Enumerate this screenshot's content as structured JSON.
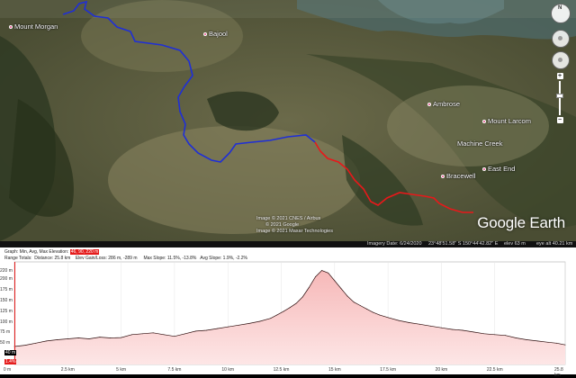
{
  "map": {
    "places": [
      {
        "id": "mount-morgan",
        "label": "Mount Morgan"
      },
      {
        "id": "bajool",
        "label": "Bajool"
      },
      {
        "id": "ambrose",
        "label": "Ambrose"
      },
      {
        "id": "mount-larcom",
        "label": "Mount Larcom"
      },
      {
        "id": "machine-creek",
        "label": "Machine Creek"
      },
      {
        "id": "east-end",
        "label": "East End"
      },
      {
        "id": "bracewell",
        "label": "Bracewell"
      }
    ],
    "credits": [
      "Image © 2021 CNES / Airbus",
      "© 2021 Google",
      "Image © 2021 Maxar Technologies"
    ],
    "logo": "Google Earth",
    "status": {
      "imagery_date": "Imagery Date: 6/24/2020",
      "coords": "23°48'51.58\" S  150°44'42.82\" E",
      "elev": "elev   63 m",
      "eye_alt": "eye alt  40.21 km"
    },
    "compass_label": "N",
    "zoom_plus": "+",
    "zoom_minus": "−",
    "route_colors": {
      "covered": "#1f2fd6",
      "remaining": "#e8181a"
    }
  },
  "profile": {
    "line1": {
      "prefix": "Graph: Min, Avg, Max Elevation:",
      "highlight": "46, 90, 220 m"
    },
    "line2": {
      "range_totals": "Range Totals:",
      "distance": "Distance: 25.8 km",
      "gain_loss": "Elev Gain/Loss: 286 m, -289 m",
      "max_slope": "Max Slope: 11.5%, -13.8%",
      "avg_slope": "Avg Slope: 1.9%, -2.2%"
    },
    "cursor": {
      "elev_label": "40 m",
      "slope_label": "1.4%",
      "fraction": 0.0
    },
    "colors": {
      "fill": "#f6b8b8",
      "line": "#2a0a0a",
      "highlight": "#e41c1c"
    }
  },
  "chart_data": {
    "type": "area",
    "title": "",
    "xlabel": "",
    "ylabel": "",
    "xlim": [
      0,
      25.8
    ],
    "ylim": [
      0,
      240
    ],
    "y_ticks": [
      "220 m",
      "200 m",
      "175 m",
      "150 m",
      "125 m",
      "100 m",
      "75 m",
      "50 m"
    ],
    "y_tick_values": [
      220,
      200,
      175,
      150,
      125,
      100,
      75,
      50
    ],
    "x_ticks": [
      "0 m",
      "2.5 km",
      "5 km",
      "7.5 km",
      "10 km",
      "12.5 km",
      "15 km",
      "17.5 km",
      "20 km",
      "22.5 km",
      "25.8 km"
    ],
    "x_tick_values": [
      0,
      2.5,
      5,
      7.5,
      10,
      12.5,
      15,
      17.5,
      20,
      22.5,
      25.8
    ],
    "series": [
      {
        "x": [
          0,
          0.5,
          1,
          1.5,
          2,
          2.5,
          3,
          3.5,
          4,
          4.5,
          5,
          5.5,
          6,
          6.5,
          7,
          7.5,
          8,
          8.5,
          9,
          9.5,
          10,
          10.5,
          11,
          11.5,
          12,
          12.3,
          12.6,
          12.9,
          13.2,
          13.5,
          13.8,
          14.1,
          14.4,
          14.7,
          15,
          15.3,
          15.6,
          15.9,
          16.2,
          16.5,
          16.8,
          17.1,
          17.5,
          18,
          18.5,
          19,
          19.5,
          20,
          20.5,
          21,
          21.5,
          22,
          22.5,
          23,
          23.5,
          24,
          24.5,
          25,
          25.4,
          25.8
        ],
        "y": [
          42,
          45,
          50,
          55,
          58,
          60,
          62,
          60,
          64,
          62,
          63,
          70,
          72,
          74,
          70,
          66,
          72,
          78,
          80,
          84,
          88,
          92,
          96,
          101,
          108,
          116,
          124,
          133,
          143,
          158,
          180,
          205,
          220,
          214,
          196,
          178,
          160,
          146,
          138,
          130,
          122,
          116,
          110,
          103,
          98,
          94,
          90,
          86,
          82,
          80,
          76,
          72,
          70,
          68,
          62,
          58,
          55,
          52,
          50,
          46
        ]
      }
    ]
  }
}
